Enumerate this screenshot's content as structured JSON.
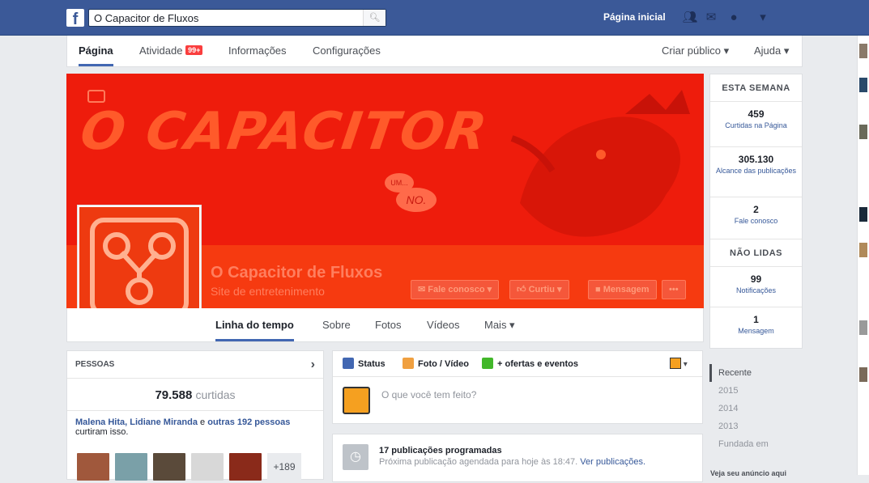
{
  "topbar": {
    "logo": "f",
    "search_value": "O Capacitor de Fluxos",
    "search_icon": "search-icon",
    "home_label": "Página inicial",
    "icons": [
      "friends-icon",
      "messages-icon",
      "globe-icon",
      "settings-icon"
    ],
    "colors": {
      "bar": "#3b5998"
    }
  },
  "pagenav": {
    "tabs": [
      {
        "label": "Página"
      },
      {
        "label": "Atividade",
        "badge": "99+"
      },
      {
        "label": "Informações"
      },
      {
        "label": "Configurações"
      }
    ],
    "right": [
      {
        "label": "Criar público ▾"
      },
      {
        "label": "Ajuda ▾"
      }
    ]
  },
  "cover": {
    "art_title": "O CAPACITOR",
    "speech_small": "UM...",
    "speech_big": "NO.",
    "page_name": "O Capacitor de Fluxos",
    "page_category": "Site de entretenimento",
    "buttons": [
      {
        "label": "Fale conosco ▾"
      },
      {
        "label": "Curtiu ▾"
      },
      {
        "label": "Mensagem"
      },
      {
        "label": "•••"
      }
    ],
    "colors": {
      "red": "#ee1c0c"
    }
  },
  "timeline_nav": {
    "tabs": [
      {
        "label": "Linha do tempo"
      },
      {
        "label": "Sobre"
      },
      {
        "label": "Fotos"
      },
      {
        "label": "Vídeos"
      },
      {
        "label": "Mais ▾"
      }
    ]
  },
  "stats": {
    "week_header": "ESTA SEMANA",
    "week": [
      {
        "value": "459",
        "label": "Curtidas na Página"
      },
      {
        "value": "305.130",
        "label": "Alcance das publicações"
      },
      {
        "value": "2",
        "label": "Fale conosco"
      }
    ],
    "unread_header": "NÃO LIDAS",
    "unread": [
      {
        "value": "99",
        "label": "Notificações"
      },
      {
        "value": "1",
        "label": "Mensagem"
      }
    ]
  },
  "people": {
    "header": "PESSOAS",
    "likes_count": "79.588",
    "likes_word": "curtidas",
    "friend_names": "Malena Hita, Lidiane Miranda",
    "friend_rest": " e ",
    "friend_others": "outras 192 pessoas",
    "friend_suffix": "curtiram isso.",
    "more_count": "+189"
  },
  "composer": {
    "tabs": [
      {
        "label": "Status"
      },
      {
        "label": "Foto / Vídeo"
      },
      {
        "label": "+ ofertas e eventos"
      }
    ],
    "prompt": "O que você tem feito?"
  },
  "scheduled": {
    "title": "17 publicações programadas",
    "detail": "Próxima publicação agendada para hoje às 18:47. ",
    "link": "Ver publicações."
  },
  "years": {
    "items": [
      "Recente",
      "2015",
      "2014",
      "2013",
      "Fundada em"
    ]
  },
  "ad_text": "Veja seu anúncio aqui"
}
